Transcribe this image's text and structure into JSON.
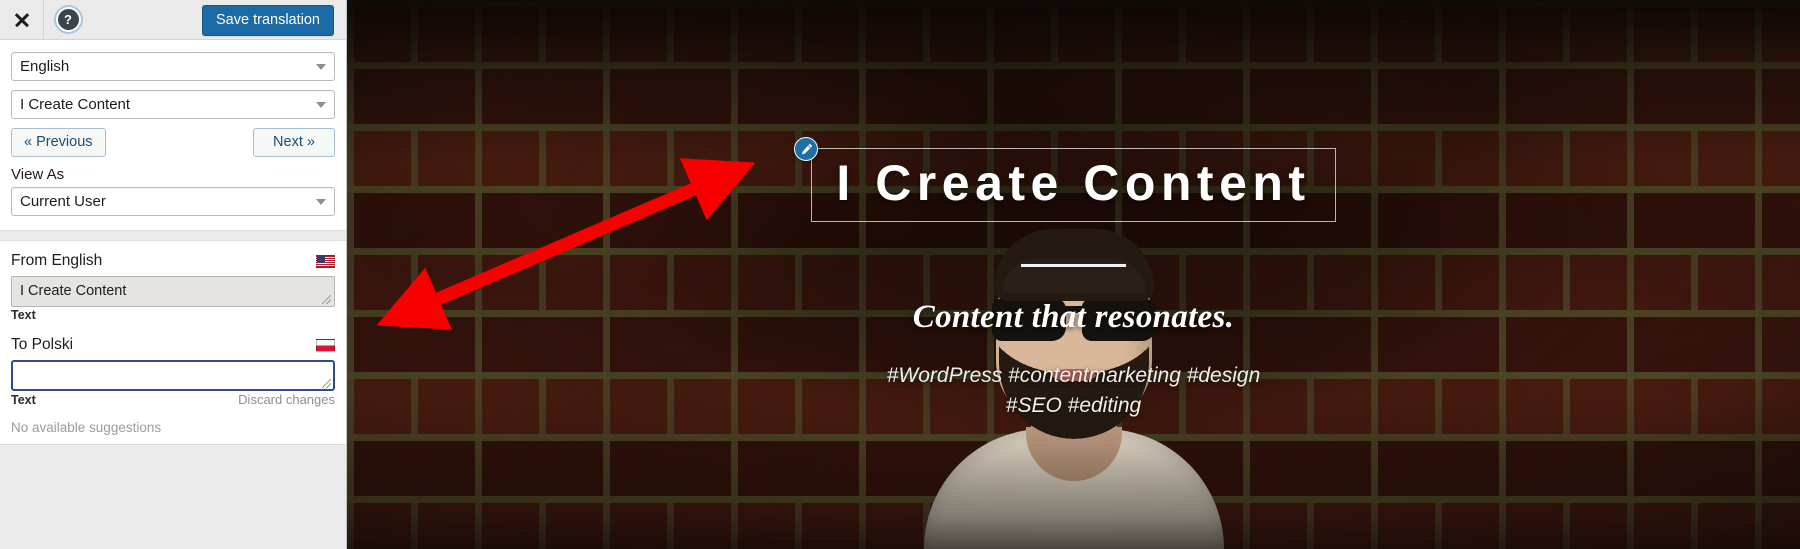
{
  "toolbar": {
    "close_icon": "close-icon",
    "help_icon": "help-icon",
    "help_glyph": "?",
    "save_label": "Save translation",
    "save_color": "#1b6aa5"
  },
  "sidebar": {
    "language_select": {
      "value": "English",
      "caret": "chevron-down-icon"
    },
    "string_select": {
      "value": "I Create Content",
      "caret": "chevron-down-icon"
    },
    "prev_label": "« Previous",
    "next_label": "Next »",
    "view_as_label": "View As",
    "view_as_select": {
      "value": "Current User",
      "caret": "chevron-down-icon"
    },
    "source": {
      "title": "From English",
      "flag": "flag-us-icon",
      "value": "I Create Content",
      "meta_label": "Text"
    },
    "target": {
      "title": "To Polski",
      "flag": "flag-pl-icon",
      "value": "",
      "placeholder": "",
      "meta_label": "Text",
      "discard_label": "Discard changes",
      "suggestions": "No available suggestions"
    }
  },
  "preview": {
    "edit_badge_icon": "pencil-edit-icon",
    "hero_title": "I Create Content",
    "tagline": "Content that resonates.",
    "hashtags": "#WordPress #contentmarketing #design #SEO #editing",
    "annotation": {
      "name": "red-double-arrow",
      "color": "#f70000"
    }
  }
}
